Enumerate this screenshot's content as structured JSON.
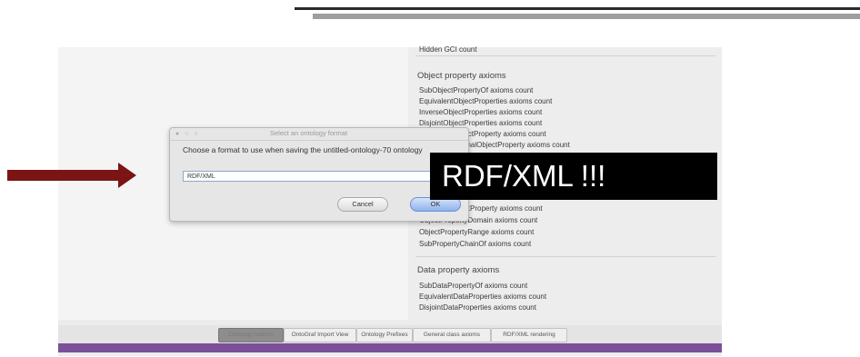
{
  "dialog": {
    "title": "Select an ontology format",
    "prompt": "Choose a format to use when saving the untitled-ontology-70 ontology",
    "format_value": "RDF/XML",
    "cancel_label": "Cancel",
    "ok_label": "OK"
  },
  "callout": {
    "text": "RDF/XML !!!"
  },
  "metrics_panel": {
    "top_row": "Hidden GCI count",
    "object_property_header": "Object property axioms",
    "object_property_rows": [
      "SubObjectPropertyOf axioms count",
      "EquivalentObjectProperties axioms count",
      "InverseObjectProperties axioms count",
      "DisjointObjectProperties axioms count",
      "FunctionalObjectProperty axioms count",
      "InverseFunctionalObjectProperty axioms count"
    ],
    "object_property_rows_lower": [
      "ReflexiveObjectProperty axioms count",
      "ObjectPropertyDomain axioms count",
      "ObjectPropertyRange axioms count",
      "SubPropertyChainOf axioms count"
    ],
    "data_property_header": "Data property axioms",
    "data_property_rows": [
      "SubDataPropertyOf axioms count",
      "EquivalentDataProperties axioms count",
      "DisjointDataProperties axioms count"
    ]
  },
  "tabs": [
    "Ontology metrics",
    "OntoGraf Import View",
    "Ontology Prefixes",
    "General class axioms",
    "RDF/XML rendering"
  ],
  "colors": {
    "arrow": "#7b1414",
    "callout_bg": "#000000",
    "accent_bar": "#7b4f9a"
  }
}
